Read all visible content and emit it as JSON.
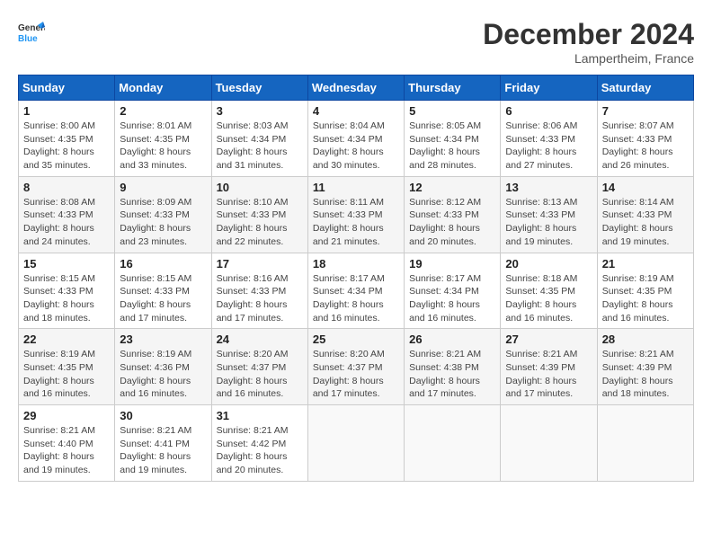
{
  "header": {
    "logo_line1": "General",
    "logo_line2": "Blue",
    "month": "December 2024",
    "location": "Lampertheim, France"
  },
  "days_of_week": [
    "Sunday",
    "Monday",
    "Tuesday",
    "Wednesday",
    "Thursday",
    "Friday",
    "Saturday"
  ],
  "weeks": [
    [
      {
        "day": "1",
        "sunrise": "8:00 AM",
        "sunset": "4:35 PM",
        "daylight": "8 hours and 35 minutes."
      },
      {
        "day": "2",
        "sunrise": "8:01 AM",
        "sunset": "4:35 PM",
        "daylight": "8 hours and 33 minutes."
      },
      {
        "day": "3",
        "sunrise": "8:03 AM",
        "sunset": "4:34 PM",
        "daylight": "8 hours and 31 minutes."
      },
      {
        "day": "4",
        "sunrise": "8:04 AM",
        "sunset": "4:34 PM",
        "daylight": "8 hours and 30 minutes."
      },
      {
        "day": "5",
        "sunrise": "8:05 AM",
        "sunset": "4:34 PM",
        "daylight": "8 hours and 28 minutes."
      },
      {
        "day": "6",
        "sunrise": "8:06 AM",
        "sunset": "4:33 PM",
        "daylight": "8 hours and 27 minutes."
      },
      {
        "day": "7",
        "sunrise": "8:07 AM",
        "sunset": "4:33 PM",
        "daylight": "8 hours and 26 minutes."
      }
    ],
    [
      {
        "day": "8",
        "sunrise": "8:08 AM",
        "sunset": "4:33 PM",
        "daylight": "8 hours and 24 minutes."
      },
      {
        "day": "9",
        "sunrise": "8:09 AM",
        "sunset": "4:33 PM",
        "daylight": "8 hours and 23 minutes."
      },
      {
        "day": "10",
        "sunrise": "8:10 AM",
        "sunset": "4:33 PM",
        "daylight": "8 hours and 22 minutes."
      },
      {
        "day": "11",
        "sunrise": "8:11 AM",
        "sunset": "4:33 PM",
        "daylight": "8 hours and 21 minutes."
      },
      {
        "day": "12",
        "sunrise": "8:12 AM",
        "sunset": "4:33 PM",
        "daylight": "8 hours and 20 minutes."
      },
      {
        "day": "13",
        "sunrise": "8:13 AM",
        "sunset": "4:33 PM",
        "daylight": "8 hours and 19 minutes."
      },
      {
        "day": "14",
        "sunrise": "8:14 AM",
        "sunset": "4:33 PM",
        "daylight": "8 hours and 19 minutes."
      }
    ],
    [
      {
        "day": "15",
        "sunrise": "8:15 AM",
        "sunset": "4:33 PM",
        "daylight": "8 hours and 18 minutes."
      },
      {
        "day": "16",
        "sunrise": "8:15 AM",
        "sunset": "4:33 PM",
        "daylight": "8 hours and 17 minutes."
      },
      {
        "day": "17",
        "sunrise": "8:16 AM",
        "sunset": "4:33 PM",
        "daylight": "8 hours and 17 minutes."
      },
      {
        "day": "18",
        "sunrise": "8:17 AM",
        "sunset": "4:34 PM",
        "daylight": "8 hours and 16 minutes."
      },
      {
        "day": "19",
        "sunrise": "8:17 AM",
        "sunset": "4:34 PM",
        "daylight": "8 hours and 16 minutes."
      },
      {
        "day": "20",
        "sunrise": "8:18 AM",
        "sunset": "4:35 PM",
        "daylight": "8 hours and 16 minutes."
      },
      {
        "day": "21",
        "sunrise": "8:19 AM",
        "sunset": "4:35 PM",
        "daylight": "8 hours and 16 minutes."
      }
    ],
    [
      {
        "day": "22",
        "sunrise": "8:19 AM",
        "sunset": "4:35 PM",
        "daylight": "8 hours and 16 minutes."
      },
      {
        "day": "23",
        "sunrise": "8:19 AM",
        "sunset": "4:36 PM",
        "daylight": "8 hours and 16 minutes."
      },
      {
        "day": "24",
        "sunrise": "8:20 AM",
        "sunset": "4:37 PM",
        "daylight": "8 hours and 16 minutes."
      },
      {
        "day": "25",
        "sunrise": "8:20 AM",
        "sunset": "4:37 PM",
        "daylight": "8 hours and 17 minutes."
      },
      {
        "day": "26",
        "sunrise": "8:21 AM",
        "sunset": "4:38 PM",
        "daylight": "8 hours and 17 minutes."
      },
      {
        "day": "27",
        "sunrise": "8:21 AM",
        "sunset": "4:39 PM",
        "daylight": "8 hours and 17 minutes."
      },
      {
        "day": "28",
        "sunrise": "8:21 AM",
        "sunset": "4:39 PM",
        "daylight": "8 hours and 18 minutes."
      }
    ],
    [
      {
        "day": "29",
        "sunrise": "8:21 AM",
        "sunset": "4:40 PM",
        "daylight": "8 hours and 19 minutes."
      },
      {
        "day": "30",
        "sunrise": "8:21 AM",
        "sunset": "4:41 PM",
        "daylight": "8 hours and 19 minutes."
      },
      {
        "day": "31",
        "sunrise": "8:21 AM",
        "sunset": "4:42 PM",
        "daylight": "8 hours and 20 minutes."
      },
      null,
      null,
      null,
      null
    ]
  ]
}
